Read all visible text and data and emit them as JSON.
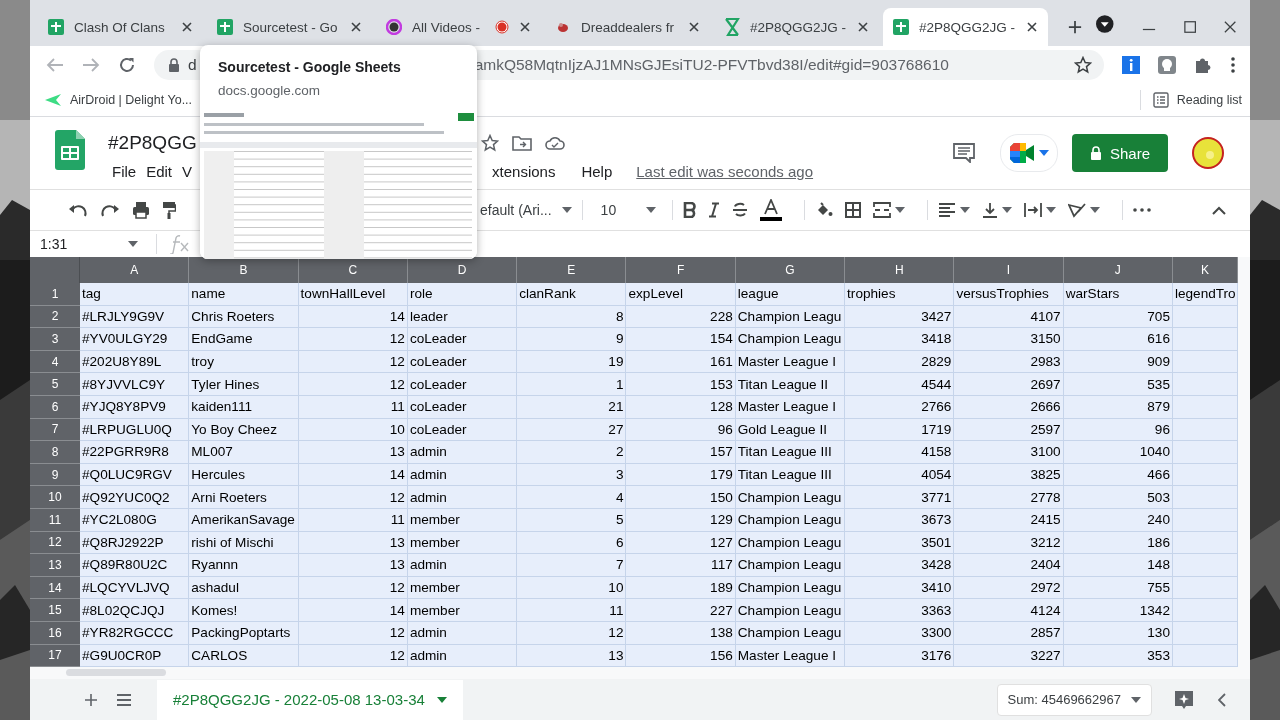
{
  "browser": {
    "tabs": [
      {
        "title": "Clash Of Clans",
        "kind": "sheets",
        "selected": false,
        "recording": false
      },
      {
        "title": "Sourcetest - Go",
        "kind": "sheets",
        "selected": false,
        "recording": false
      },
      {
        "title": "All Videos -",
        "kind": "ring",
        "selected": false,
        "recording": true
      },
      {
        "title": "Dreaddealers fr",
        "selected": false,
        "recording": false
      },
      {
        "title": "#2P8QGG2JG -",
        "kind": "excel",
        "selected": false,
        "recording": false
      },
      {
        "title": "#2P8QGG2JG -",
        "kind": "sheets",
        "selected": true,
        "recording": false
      }
    ],
    "address": {
      "url_start": "d",
      "url_end": "amkQ58MqtnIjzAJ1MNsGJEsiTU2-PFVTbvd38I/edit#gid=903768610"
    },
    "bookmarks": [
      {
        "title": "AirDroid | Delight Yo..."
      }
    ],
    "reading_list": "Reading list",
    "tab_preview": {
      "title": "Sourcetest - Google Sheets",
      "domain": "docs.google.com",
      "kind": "picture"
    }
  },
  "sheet": {
    "title": "#2P8QGG",
    "menu": [
      "File",
      "Edit",
      "V",
      "xtensions",
      "Help"
    ],
    "last_edit": "Last edit was seconds ago",
    "share": "Share",
    "toolbar": {
      "font": "efault (Ari...",
      "font_size": "10"
    },
    "name_box": "1:31",
    "all_selected": true,
    "columns": [
      {
        "letter": "A",
        "kind": "text"
      },
      {
        "letter": "B",
        "kind": "text"
      },
      {
        "letter": "C",
        "kind": "number"
      },
      {
        "letter": "D",
        "kind": "text"
      },
      {
        "letter": "E",
        "kind": "number"
      },
      {
        "letter": "F",
        "kind": "number"
      },
      {
        "letter": "G",
        "kind": "text"
      },
      {
        "letter": "H",
        "kind": "number"
      },
      {
        "letter": "I",
        "kind": "number"
      },
      {
        "letter": "J",
        "kind": "number"
      },
      {
        "letter": "K",
        "kind": "text"
      }
    ],
    "rows": [
      {
        "number": "1",
        "kind": "header",
        "cells": [
          "tag",
          "name",
          "townHallLevel",
          "role",
          "clanRank",
          "expLevel",
          "league",
          "trophies",
          "versusTrophies",
          "warStars",
          "legendTro"
        ]
      },
      {
        "number": "2",
        "kind": "data",
        "cells": [
          "#LRJLY9G9V",
          "Chris Roeters",
          "14",
          "leader",
          "8",
          "228",
          "Champion Leagu",
          "3427",
          "4107",
          "705"
        ]
      },
      {
        "number": "3",
        "kind": "data",
        "cells": [
          "#YV0ULGY29",
          "EndGame",
          "12",
          "coLeader",
          "9",
          "154",
          "Champion Leagu",
          "3418",
          "3150",
          "616"
        ]
      },
      {
        "number": "4",
        "kind": "data",
        "cells": [
          "#202U8Y89L",
          "troy",
          "12",
          "coLeader",
          "19",
          "161",
          "Master League I",
          "2829",
          "2983",
          "909"
        ]
      },
      {
        "number": "5",
        "kind": "data",
        "cells": [
          "#8YJVVLC9Y",
          "Tyler Hines",
          "12",
          "coLeader",
          "1",
          "153",
          "Titan League II",
          "4544",
          "2697",
          "535"
        ]
      },
      {
        "number": "6",
        "kind": "data",
        "cells": [
          "#YJQ8Y8PV9",
          "kaiden111",
          "11",
          "coLeader",
          "21",
          "128",
          "Master League I",
          "2766",
          "2666",
          "879"
        ]
      },
      {
        "number": "7",
        "kind": "data",
        "cells": [
          "#LRPUGLU0Q",
          "Yo Boy Cheez",
          "10",
          "coLeader",
          "27",
          "96",
          "Gold League II",
          "1719",
          "2597",
          "96"
        ]
      },
      {
        "number": "8",
        "kind": "data",
        "cells": [
          "#22PGRR9R8",
          "ML007",
          "13",
          "admin",
          "2",
          "157",
          "Titan League III",
          "4158",
          "3100",
          "1040"
        ]
      },
      {
        "number": "9",
        "kind": "data",
        "cells": [
          "#Q0LUC9RGV",
          "Hercules",
          "14",
          "admin",
          "3",
          "179",
          "Titan League III",
          "4054",
          "3825",
          "466"
        ]
      },
      {
        "number": "10",
        "kind": "data",
        "cells": [
          "#Q92YUC0Q2",
          "Arni Roeters",
          "12",
          "admin",
          "4",
          "150",
          "Champion Leagu",
          "3771",
          "2778",
          "503"
        ]
      },
      {
        "number": "11",
        "kind": "data",
        "cells": [
          "#YC2L080G",
          "AmerikanSavage",
          "11",
          "member",
          "5",
          "129",
          "Champion Leagu",
          "3673",
          "2415",
          "240"
        ]
      },
      {
        "number": "12",
        "kind": "data",
        "cells": [
          "#Q8RJ2922P",
          "rishi of Mischi",
          "13",
          "member",
          "6",
          "127",
          "Champion Leagu",
          "3501",
          "3212",
          "186"
        ]
      },
      {
        "number": "13",
        "kind": "data",
        "cells": [
          "#Q89R80U2C",
          "Ryannn",
          "13",
          "admin",
          "7",
          "117",
          "Champion Leagu",
          "3428",
          "2404",
          "148"
        ]
      },
      {
        "number": "14",
        "kind": "data",
        "cells": [
          "#LQCYVLJVQ",
          "ashadul",
          "12",
          "member",
          "10",
          "189",
          "Champion Leagu",
          "3410",
          "2972",
          "755"
        ]
      },
      {
        "number": "15",
        "kind": "data",
        "cells": [
          "#8L02QCJQJ",
          "Komes!",
          "14",
          "member",
          "11",
          "227",
          "Champion Leagu",
          "3363",
          "4124",
          "1342"
        ]
      },
      {
        "number": "16",
        "kind": "data",
        "cells": [
          "#YR82RGCCC",
          "PackingPoptarts",
          "12",
          "admin",
          "12",
          "138",
          "Champion Leagu",
          "3300",
          "2857",
          "130"
        ]
      },
      {
        "number": "17",
        "kind": "data",
        "cells": [
          "#G9U0CR0P",
          "CARLOS",
          "12",
          "admin",
          "13",
          "156",
          "Master League I",
          "3176",
          "3227",
          "353"
        ]
      }
    ],
    "sheet_tabs": [
      {
        "label": "#2P8QGG2JG - 2022-05-08 13-03-34",
        "selected": true
      }
    ],
    "sum": "Sum: 45469662967"
  }
}
